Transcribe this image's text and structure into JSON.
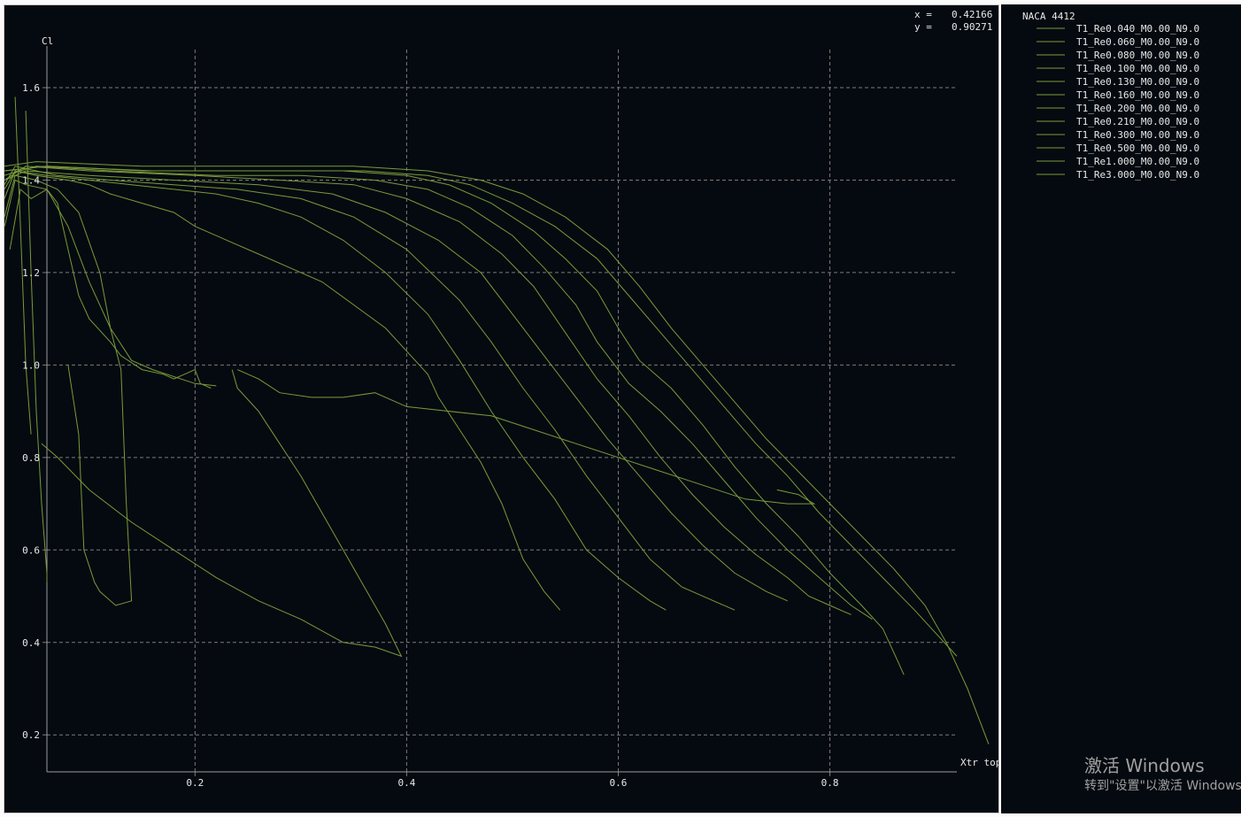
{
  "cursor_readout": {
    "x_label": "x =",
    "x_value": "0.42166",
    "y_label": "y =",
    "y_value": "0.90271"
  },
  "legend": {
    "title": "NACA 4412",
    "entries": [
      "T1_Re0.040_M0.00_N9.0",
      "T1_Re0.060_M0.00_N9.0",
      "T1_Re0.080_M0.00_N9.0",
      "T1_Re0.100_M0.00_N9.0",
      "T1_Re0.130_M0.00_N9.0",
      "T1_Re0.160_M0.00_N9.0",
      "T1_Re0.200_M0.00_N9.0",
      "T1_Re0.210_M0.00_N9.0",
      "T1_Re0.300_M0.00_N9.0",
      "T1_Re0.500_M0.00_N9.0",
      "T1_Re1.000_M0.00_N9.0",
      "T1_Re3.000_M0.00_N9.0"
    ]
  },
  "watermark": {
    "line1": "激活 Windows",
    "line2": "转到\"设置\"以激活 Windows。"
  },
  "colors": {
    "background": "#050a10",
    "grid": "#7a7a7a",
    "curve": "#7a9a3a",
    "text": "#e8e8e8"
  },
  "chart_data": {
    "type": "line",
    "xlabel": "Xtr top",
    "ylabel": "Cl",
    "xlim": [
      0.06,
      0.92
    ],
    "ylim": [
      0.12,
      1.69
    ],
    "xticks": [
      0.2,
      0.4,
      0.6,
      0.8
    ],
    "xtick_labels": [
      "0.2",
      "0.4",
      "0.6",
      "0.8"
    ],
    "yticks": [
      0.2,
      0.4,
      0.6,
      0.8,
      1.0,
      1.2,
      1.4,
      1.6
    ],
    "ytick_labels": [
      "0.2",
      "0.4",
      "0.6",
      "0.8",
      "1.0",
      "1.2",
      "1.4",
      "1.6"
    ],
    "grid": true,
    "legend_position": "right panel",
    "series": [
      {
        "name": "T1_Re0.040_M0.00_N9.0",
        "points": [
          [
            0.025,
            1.25
          ],
          [
            0.035,
            1.38
          ],
          [
            0.045,
            1.36
          ],
          [
            0.06,
            1.38
          ],
          [
            0.07,
            1.35
          ],
          [
            0.08,
            1.25
          ],
          [
            0.09,
            1.15
          ],
          [
            0.1,
            1.1
          ],
          [
            0.12,
            1.05
          ],
          [
            0.13,
            1.02
          ],
          [
            0.15,
            0.99
          ],
          [
            0.17,
            0.98
          ],
          [
            0.18,
            0.97
          ],
          [
            0.19,
            0.98
          ],
          [
            0.2,
            0.99
          ],
          [
            0.205,
            0.96
          ],
          [
            0.215,
            0.95
          ]
        ]
      },
      {
        "name": "T1_Re0.060_M0.00_N9.0",
        "points": [
          [
            0.02,
            1.3
          ],
          [
            0.03,
            1.4
          ],
          [
            0.04,
            1.39
          ],
          [
            0.06,
            1.38
          ],
          [
            0.08,
            1.3
          ],
          [
            0.1,
            1.18
          ],
          [
            0.12,
            1.08
          ],
          [
            0.14,
            1.01
          ],
          [
            0.16,
            0.99
          ],
          [
            0.2,
            0.96
          ],
          [
            0.22,
            0.955
          ]
        ]
      },
      {
        "name": "T1_Re0.080_M0.00_N9.0",
        "points": [
          [
            0.015,
            1.32
          ],
          [
            0.03,
            1.41
          ],
          [
            0.05,
            1.4
          ],
          [
            0.07,
            1.38
          ],
          [
            0.09,
            1.33
          ],
          [
            0.11,
            1.2
          ],
          [
            0.12,
            1.08
          ],
          [
            0.13,
            0.99
          ],
          [
            0.135,
            0.7
          ],
          [
            0.14,
            0.49
          ],
          [
            0.125,
            0.48
          ],
          [
            0.11,
            0.51
          ],
          [
            0.105,
            0.53
          ],
          [
            0.095,
            0.6
          ],
          [
            0.09,
            0.85
          ],
          [
            0.08,
            1.0
          ]
        ]
      },
      {
        "name": "T1_Re0.100_M0.00_N9.0",
        "points": [
          [
            0.01,
            1.36
          ],
          [
            0.03,
            1.42
          ],
          [
            0.05,
            1.41
          ],
          [
            0.08,
            1.4
          ],
          [
            0.1,
            1.39
          ],
          [
            0.12,
            1.37
          ],
          [
            0.15,
            1.35
          ],
          [
            0.18,
            1.33
          ],
          [
            0.2,
            1.3
          ],
          [
            0.23,
            1.27
          ],
          [
            0.26,
            1.24
          ],
          [
            0.29,
            1.21
          ],
          [
            0.32,
            1.18
          ],
          [
            0.35,
            1.13
          ],
          [
            0.38,
            1.08
          ],
          [
            0.4,
            1.03
          ],
          [
            0.42,
            0.98
          ],
          [
            0.43,
            0.93
          ],
          [
            0.45,
            0.86
          ],
          [
            0.47,
            0.79
          ],
          [
            0.49,
            0.7
          ],
          [
            0.51,
            0.58
          ],
          [
            0.53,
            0.51
          ],
          [
            0.545,
            0.47
          ]
        ]
      },
      {
        "name": "T1_Re0.130_M0.00_N9.0",
        "points": [
          [
            0.01,
            1.38
          ],
          [
            0.03,
            1.42
          ],
          [
            0.06,
            1.41
          ],
          [
            0.1,
            1.4
          ],
          [
            0.14,
            1.39
          ],
          [
            0.18,
            1.38
          ],
          [
            0.22,
            1.37
          ],
          [
            0.26,
            1.35
          ],
          [
            0.3,
            1.32
          ],
          [
            0.34,
            1.27
          ],
          [
            0.38,
            1.2
          ],
          [
            0.42,
            1.11
          ],
          [
            0.45,
            1.01
          ],
          [
            0.48,
            0.9
          ],
          [
            0.51,
            0.8
          ],
          [
            0.54,
            0.71
          ],
          [
            0.57,
            0.6
          ],
          [
            0.6,
            0.54
          ],
          [
            0.63,
            0.49
          ],
          [
            0.645,
            0.47
          ]
        ]
      },
      {
        "name": "T1_Re0.160_M0.00_N9.0",
        "points": [
          [
            0.01,
            1.39
          ],
          [
            0.03,
            1.43
          ],
          [
            0.07,
            1.41
          ],
          [
            0.12,
            1.4
          ],
          [
            0.18,
            1.39
          ],
          [
            0.24,
            1.38
          ],
          [
            0.3,
            1.36
          ],
          [
            0.35,
            1.32
          ],
          [
            0.4,
            1.25
          ],
          [
            0.45,
            1.14
          ],
          [
            0.48,
            1.05
          ],
          [
            0.51,
            0.95
          ],
          [
            0.54,
            0.86
          ],
          [
            0.57,
            0.76
          ],
          [
            0.6,
            0.67
          ],
          [
            0.63,
            0.58
          ],
          [
            0.66,
            0.52
          ],
          [
            0.69,
            0.49
          ],
          [
            0.71,
            0.47
          ]
        ]
      },
      {
        "name": "T1_Re0.200_M0.00_N9.0",
        "points": [
          [
            0.01,
            1.4
          ],
          [
            0.04,
            1.42
          ],
          [
            0.1,
            1.41
          ],
          [
            0.18,
            1.4
          ],
          [
            0.26,
            1.39
          ],
          [
            0.33,
            1.37
          ],
          [
            0.38,
            1.33
          ],
          [
            0.43,
            1.27
          ],
          [
            0.47,
            1.2
          ],
          [
            0.5,
            1.11
          ],
          [
            0.53,
            1.02
          ],
          [
            0.56,
            0.93
          ],
          [
            0.59,
            0.84
          ],
          [
            0.62,
            0.76
          ],
          [
            0.65,
            0.68
          ],
          [
            0.68,
            0.61
          ],
          [
            0.71,
            0.55
          ],
          [
            0.74,
            0.51
          ],
          [
            0.76,
            0.49
          ]
        ]
      },
      {
        "name": "T1_Re0.210_M0.00_N9.0",
        "points": [
          [
            0.01,
            1.4
          ],
          [
            0.04,
            1.43
          ],
          [
            0.1,
            1.42
          ],
          [
            0.2,
            1.41
          ],
          [
            0.28,
            1.4
          ],
          [
            0.35,
            1.39
          ],
          [
            0.4,
            1.36
          ],
          [
            0.45,
            1.31
          ],
          [
            0.49,
            1.24
          ],
          [
            0.52,
            1.17
          ],
          [
            0.55,
            1.07
          ],
          [
            0.58,
            0.97
          ],
          [
            0.61,
            0.89
          ],
          [
            0.64,
            0.8
          ],
          [
            0.67,
            0.72
          ],
          [
            0.7,
            0.65
          ],
          [
            0.73,
            0.59
          ],
          [
            0.76,
            0.54
          ],
          [
            0.78,
            0.5
          ],
          [
            0.8,
            0.48
          ],
          [
            0.82,
            0.46
          ]
        ]
      },
      {
        "name": "T1_Re0.300_M0.00_N9.0",
        "points": [
          [
            0.01,
            1.41
          ],
          [
            0.05,
            1.43
          ],
          [
            0.12,
            1.42
          ],
          [
            0.22,
            1.41
          ],
          [
            0.3,
            1.41
          ],
          [
            0.37,
            1.4
          ],
          [
            0.42,
            1.38
          ],
          [
            0.46,
            1.34
          ],
          [
            0.5,
            1.28
          ],
          [
            0.53,
            1.21
          ],
          [
            0.56,
            1.13
          ],
          [
            0.58,
            1.05
          ],
          [
            0.61,
            0.96
          ],
          [
            0.64,
            0.9
          ],
          [
            0.67,
            0.83
          ],
          [
            0.7,
            0.75
          ],
          [
            0.73,
            0.67
          ],
          [
            0.76,
            0.6
          ],
          [
            0.79,
            0.54
          ],
          [
            0.82,
            0.48
          ],
          [
            0.84,
            0.45
          ]
        ]
      },
      {
        "name": "T1_Re0.500_M0.00_N9.0",
        "points": [
          [
            0.01,
            1.42
          ],
          [
            0.06,
            1.43
          ],
          [
            0.15,
            1.42
          ],
          [
            0.25,
            1.42
          ],
          [
            0.34,
            1.42
          ],
          [
            0.4,
            1.41
          ],
          [
            0.44,
            1.39
          ],
          [
            0.48,
            1.35
          ],
          [
            0.52,
            1.29
          ],
          [
            0.55,
            1.23
          ],
          [
            0.58,
            1.16
          ],
          [
            0.6,
            1.08
          ],
          [
            0.62,
            1.01
          ],
          [
            0.65,
            0.95
          ],
          [
            0.68,
            0.87
          ],
          [
            0.71,
            0.78
          ],
          [
            0.74,
            0.7
          ],
          [
            0.77,
            0.63
          ],
          [
            0.8,
            0.55
          ],
          [
            0.83,
            0.48
          ],
          [
            0.85,
            0.43
          ],
          [
            0.86,
            0.38
          ],
          [
            0.87,
            0.33
          ]
        ]
      },
      {
        "name": "T1_Re1.000_M0.00_N9.0",
        "points": [
          [
            0.01,
            1.42
          ],
          [
            0.06,
            1.43
          ],
          [
            0.16,
            1.42
          ],
          [
            0.26,
            1.42
          ],
          [
            0.36,
            1.42
          ],
          [
            0.42,
            1.41
          ],
          [
            0.46,
            1.39
          ],
          [
            0.5,
            1.35
          ],
          [
            0.54,
            1.3
          ],
          [
            0.58,
            1.23
          ],
          [
            0.61,
            1.15
          ],
          [
            0.64,
            1.07
          ],
          [
            0.67,
            0.99
          ],
          [
            0.7,
            0.91
          ],
          [
            0.73,
            0.83
          ],
          [
            0.76,
            0.76
          ],
          [
            0.79,
            0.68
          ],
          [
            0.82,
            0.61
          ],
          [
            0.85,
            0.54
          ],
          [
            0.88,
            0.47
          ],
          [
            0.9,
            0.42
          ],
          [
            0.92,
            0.37
          ]
        ]
      },
      {
        "name": "T1_Re3.000_M0.00_N9.0",
        "points": [
          [
            0.01,
            1.43
          ],
          [
            0.05,
            1.44
          ],
          [
            0.15,
            1.43
          ],
          [
            0.25,
            1.43
          ],
          [
            0.35,
            1.43
          ],
          [
            0.42,
            1.42
          ],
          [
            0.47,
            1.4
          ],
          [
            0.51,
            1.37
          ],
          [
            0.55,
            1.32
          ],
          [
            0.59,
            1.25
          ],
          [
            0.62,
            1.17
          ],
          [
            0.65,
            1.08
          ],
          [
            0.68,
            1.0
          ],
          [
            0.71,
            0.92
          ],
          [
            0.74,
            0.84
          ],
          [
            0.77,
            0.77
          ],
          [
            0.8,
            0.7
          ],
          [
            0.83,
            0.63
          ],
          [
            0.86,
            0.56
          ],
          [
            0.89,
            0.48
          ],
          [
            0.91,
            0.4
          ],
          [
            0.93,
            0.3
          ],
          [
            0.95,
            0.18
          ]
        ]
      },
      {
        "name": "",
        "points": [
          [
            0.24,
            0.99
          ],
          [
            0.26,
            0.97
          ],
          [
            0.28,
            0.94
          ],
          [
            0.31,
            0.93
          ],
          [
            0.34,
            0.93
          ],
          [
            0.37,
            0.94
          ],
          [
            0.4,
            0.91
          ],
          [
            0.44,
            0.9
          ],
          [
            0.48,
            0.89
          ],
          [
            0.52,
            0.86
          ],
          [
            0.56,
            0.83
          ],
          [
            0.6,
            0.8
          ],
          [
            0.64,
            0.77
          ],
          [
            0.68,
            0.74
          ],
          [
            0.72,
            0.71
          ],
          [
            0.76,
            0.7
          ],
          [
            0.785,
            0.7
          ],
          [
            0.77,
            0.72
          ],
          [
            0.75,
            0.73
          ]
        ]
      },
      {
        "name": "",
        "points": [
          [
            0.235,
            0.99
          ],
          [
            0.24,
            0.95
          ],
          [
            0.26,
            0.9
          ],
          [
            0.28,
            0.83
          ],
          [
            0.3,
            0.76
          ],
          [
            0.32,
            0.68
          ],
          [
            0.34,
            0.6
          ],
          [
            0.36,
            0.52
          ],
          [
            0.38,
            0.44
          ],
          [
            0.395,
            0.37
          ],
          [
            0.37,
            0.39
          ],
          [
            0.34,
            0.4
          ],
          [
            0.3,
            0.45
          ],
          [
            0.26,
            0.49
          ],
          [
            0.22,
            0.54
          ],
          [
            0.18,
            0.6
          ],
          [
            0.14,
            0.66
          ],
          [
            0.1,
            0.73
          ],
          [
            0.07,
            0.8
          ],
          [
            0.055,
            0.83
          ]
        ]
      },
      {
        "name": "",
        "points": [
          [
            0.04,
            1.55
          ],
          [
            0.045,
            1.2
          ],
          [
            0.05,
            0.9
          ],
          [
            0.055,
            0.7
          ],
          [
            0.06,
            0.55
          ],
          [
            0.06,
            0.53
          ]
        ]
      },
      {
        "name": "",
        "points": [
          [
            0.03,
            1.58
          ],
          [
            0.035,
            1.3
          ],
          [
            0.04,
            1.0
          ],
          [
            0.045,
            0.85
          ]
        ]
      }
    ]
  }
}
